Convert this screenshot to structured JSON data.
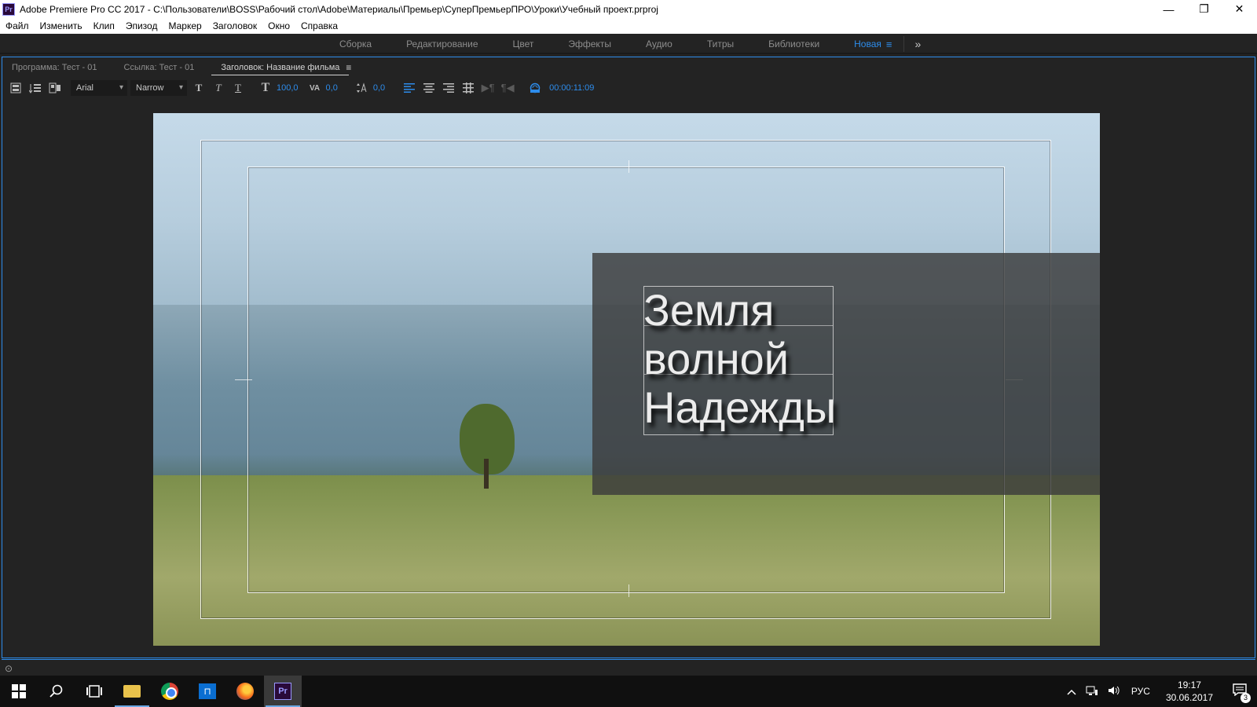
{
  "titlebar": {
    "app_icon": "Pr",
    "title": "Adobe Premiere Pro CC 2017 - C:\\Пользователи\\BOSS\\Рабочий стол\\Adobe\\Материалы\\Премьер\\СуперПремьерПРО\\Уроки\\Учебный проект.prproj",
    "minimize": "—",
    "restore": "❐",
    "close": "✕"
  },
  "menu": {
    "items": [
      {
        "label": "Файл"
      },
      {
        "label": "Изменить"
      },
      {
        "label": "Клип"
      },
      {
        "label": "Эпизод"
      },
      {
        "label": "Маркер"
      },
      {
        "label": "Заголовок"
      },
      {
        "label": "Окно"
      },
      {
        "label": "Справка"
      }
    ]
  },
  "workspaces": {
    "tabs": [
      {
        "label": "Сборка"
      },
      {
        "label": "Редактирование"
      },
      {
        "label": "Цвет"
      },
      {
        "label": "Эффекты"
      },
      {
        "label": "Аудио"
      },
      {
        "label": "Титры"
      },
      {
        "label": "Библиотеки"
      },
      {
        "label": "Новая"
      }
    ],
    "active_menu_icon": "≡",
    "more_icon": "»"
  },
  "panel": {
    "tabs": [
      {
        "label": "Программа: Тест - 01"
      },
      {
        "label": "Ссылка: Тест - 01"
      },
      {
        "label": "Заголовок: Название фильма"
      }
    ],
    "tab_menu_icon": "≡"
  },
  "toolbar": {
    "font_family": "Arial",
    "font_style": "Narrow",
    "font_size": "100,0",
    "kerning": "0,0",
    "leading": "0,0",
    "timecode": "00:00:11:09"
  },
  "title_card": {
    "lines": [
      "Земля",
      "волной",
      "Надежды"
    ]
  },
  "taskbar": {
    "store_label": "⊓",
    "pr_label": "Pr",
    "lang": "РУС",
    "time": "19:17",
    "date": "30.06.2017",
    "notification_count": "3"
  },
  "colors": {
    "accent": "#2d8ceb",
    "panel_bg": "#232323",
    "taskbar_bg": "#101010"
  }
}
